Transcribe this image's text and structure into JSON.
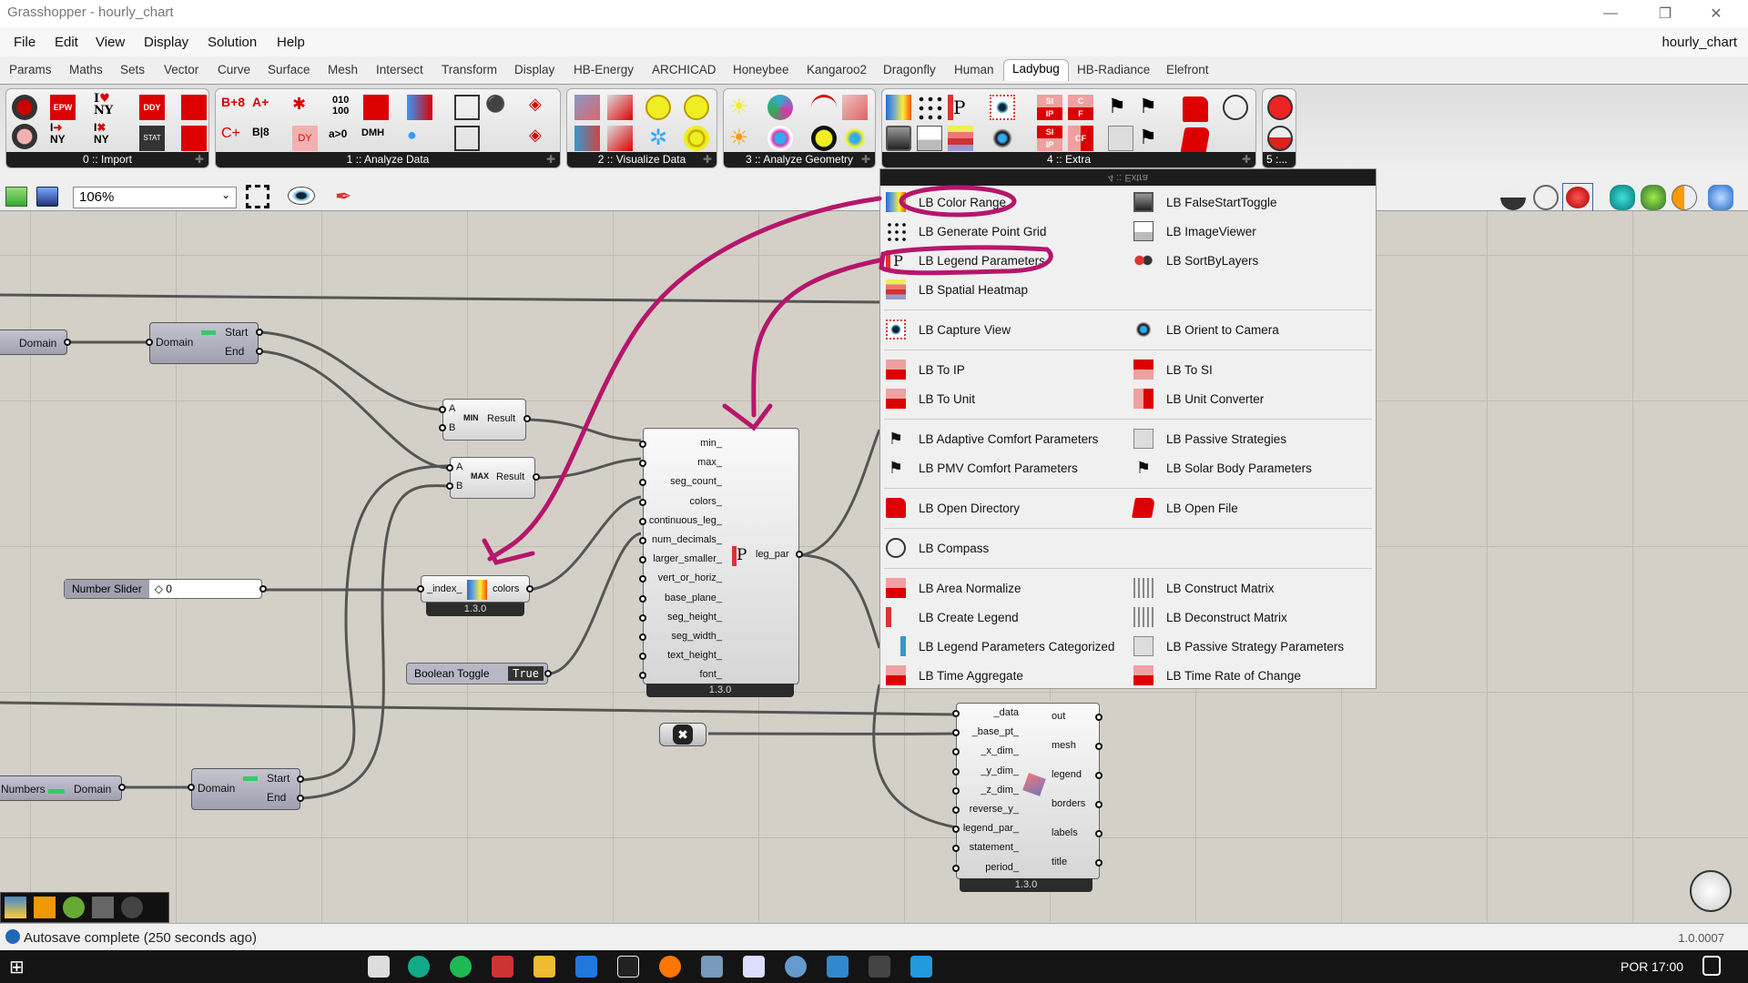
{
  "window": {
    "title": "Grasshopper - hourly_chart",
    "doc_name": "hourly_chart"
  },
  "menu": [
    "File",
    "Edit",
    "View",
    "Display",
    "Solution",
    "Help"
  ],
  "tabs": [
    "Params",
    "Maths",
    "Sets",
    "Vector",
    "Curve",
    "Surface",
    "Mesh",
    "Intersect",
    "Transform",
    "Display",
    "HB-Energy",
    "ARCHICAD",
    "Honeybee",
    "Kangaroo2",
    "Dragonfly",
    "Human",
    "Ladybug",
    "HB-Radiance",
    "Elefront"
  ],
  "active_tab": "Ladybug",
  "ribbon_groups": [
    "0 :: Import",
    "1 :: Analyze Data",
    "2 :: Visualize Data",
    "3 :: Analyze Geometry",
    "4 :: Extra",
    "5 :..."
  ],
  "toolbar": {
    "zoom_level": "106%"
  },
  "dropdown": {
    "header": "4 :: Extra",
    "left": [
      {
        "label": "LB Color Range",
        "icon": "color-range-icon",
        "highlighted": true
      },
      {
        "label": "LB Generate Point Grid",
        "icon": "point-grid-icon"
      },
      {
        "label": "LB Legend Parameters",
        "icon": "legend-parameters-icon",
        "highlighted": true
      },
      {
        "label": "LB Spatial Heatmap",
        "icon": "heatmap-icon"
      },
      {
        "label": "LB Capture View",
        "icon": "camera-icon"
      },
      {
        "label": "LB To IP",
        "icon": "si-ip-icon"
      },
      {
        "label": "LB To Unit",
        "icon": "c-f-icon"
      },
      {
        "label": "LB Adaptive Comfort Parameters",
        "icon": "adaptive-comfort-icon"
      },
      {
        "label": "LB PMV Comfort Parameters",
        "icon": "pmv-comfort-icon"
      },
      {
        "label": "LB Open Directory",
        "icon": "folder-icon"
      },
      {
        "label": "LB Compass",
        "icon": "compass-icon"
      },
      {
        "label": "LB Area Normalize",
        "icon": "m2-icon"
      },
      {
        "label": "LB Create Legend",
        "icon": "create-legend-icon"
      },
      {
        "label": "LB Legend Parameters Categorized",
        "icon": "legend-categorized-icon"
      },
      {
        "label": "LB Time Aggregate",
        "icon": "kwh-icon"
      }
    ],
    "right": [
      {
        "label": "LB FalseStartToggle",
        "icon": "toggle-icon"
      },
      {
        "label": "LB ImageViewer",
        "icon": "image-icon"
      },
      {
        "label": "LB SortByLayers",
        "icon": "sort-layers-icon"
      },
      {
        "label": "LB Orient to Camera",
        "icon": "orient-camera-icon"
      },
      {
        "label": "LB To SI",
        "icon": "ip-si-icon"
      },
      {
        "label": "LB Unit Converter",
        "icon": "unit-converter-icon"
      },
      {
        "label": "LB Passive Strategies",
        "icon": "passive-strategies-icon"
      },
      {
        "label": "LB Solar Body Parameters",
        "icon": "solar-body-icon"
      },
      {
        "label": "LB Open File",
        "icon": "open-file-icon"
      },
      {
        "label": "LB Construct Matrix",
        "icon": "construct-matrix-icon"
      },
      {
        "label": "LB Deconstruct Matrix",
        "icon": "deconstruct-matrix-icon"
      },
      {
        "label": "LB Passive Strategy Parameters",
        "icon": "passive-params-icon"
      },
      {
        "label": "LB Time Rate of Change",
        "icon": "rate-change-icon"
      }
    ]
  },
  "canvas": {
    "domain_node1": {
      "label": "Domain"
    },
    "deconstruct1": {
      "input": "Domain",
      "outputs": [
        "Start",
        "End"
      ]
    },
    "min_node": {
      "inputs": [
        "A",
        "B"
      ],
      "tag": "MIN",
      "output": "Result"
    },
    "max_node": {
      "inputs": [
        "A",
        "B"
      ],
      "tag": "MAX",
      "output": "Result"
    },
    "slider": {
      "label": "Number Slider",
      "value": "0"
    },
    "color_range": {
      "input": "_index_",
      "output": "colors",
      "version": "1.3.0"
    },
    "toggle": {
      "label": "Boolean Toggle",
      "value": "True"
    },
    "legend_params": {
      "inputs": [
        "min_",
        "max_",
        "seg_count_",
        "colors_",
        "continuous_leg_",
        "num_decimals_",
        "larger_smaller_",
        "vert_or_horiz_",
        "base_plane_",
        "seg_height_",
        "seg_width_",
        "text_height_",
        "font_"
      ],
      "output": "leg_par",
      "version": "1.3.0"
    },
    "heatmap": {
      "inputs": [
        "_data",
        "_base_pt_",
        "_x_dim_",
        "_y_dim_",
        "_z_dim_",
        "reverse_y_",
        "legend_par_",
        "statement_",
        "period_"
      ],
      "outputs": [
        "out",
        "mesh",
        "legend",
        "borders",
        "labels",
        "title"
      ],
      "version": "1.3.0"
    },
    "domain_node2": {
      "input": "Numbers",
      "label": "Domain"
    },
    "deconstruct2": {
      "input": "Domain",
      "outputs": [
        "Start",
        "End"
      ]
    }
  },
  "status": {
    "message": "Autosave complete (250 seconds ago)",
    "version": "1.0.0007"
  },
  "taskbar": {
    "language": "POR",
    "time": "17:00"
  },
  "annotation_color": "#b5166b"
}
